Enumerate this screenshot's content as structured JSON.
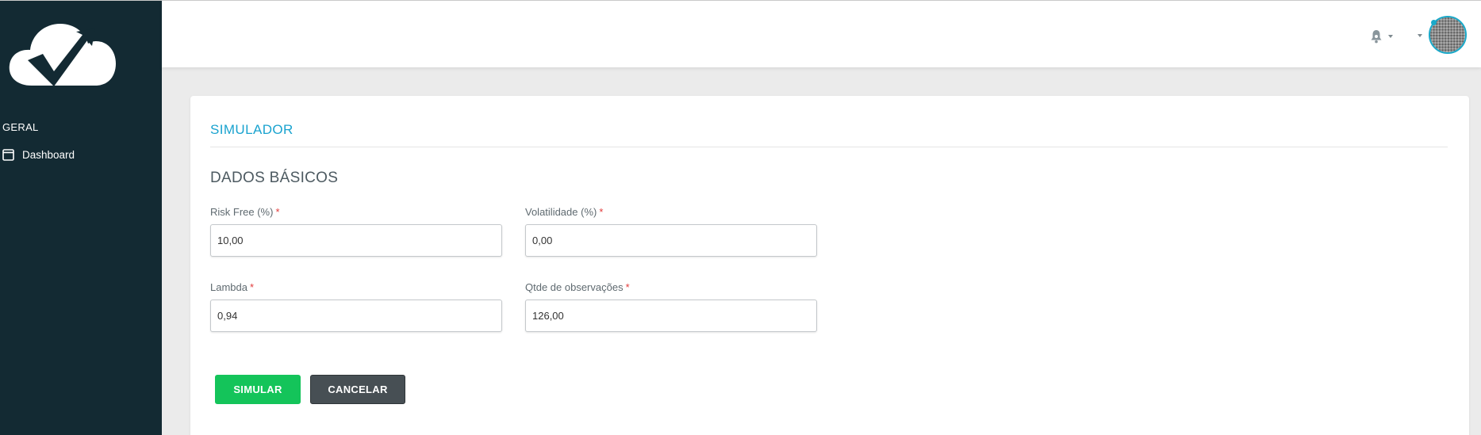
{
  "sidebar": {
    "logo": "cloud-check-arrow-logo",
    "section": "GERAL",
    "items": [
      {
        "label": "Dashboard",
        "icon": "window-icon"
      }
    ]
  },
  "header": {
    "notification_icon": "bell-icon",
    "user_avatar": "avatar"
  },
  "main": {
    "title": "SIMULADOR",
    "section_title": "DADOS BÁSICOS",
    "fields": {
      "risk_free": {
        "label": "Risk Free (%)",
        "required": "*",
        "value": "10,00"
      },
      "volatilidade": {
        "label": "Volatilidade (%)",
        "required": "*",
        "value": "0,00"
      },
      "lambda": {
        "label": "Lambda",
        "required": "*",
        "value": "0,94"
      },
      "qtde": {
        "label": "Qtde de observações",
        "required": "*",
        "value": "126,00"
      }
    },
    "buttons": {
      "simular": "SIMULAR",
      "cancelar": "CANCELAR"
    }
  },
  "colors": {
    "sidebar": "#132a33",
    "accent": "#1aa3cf",
    "primary_button": "#14c45a",
    "secondary_button": "#474f54",
    "required": "#e23b3b"
  }
}
